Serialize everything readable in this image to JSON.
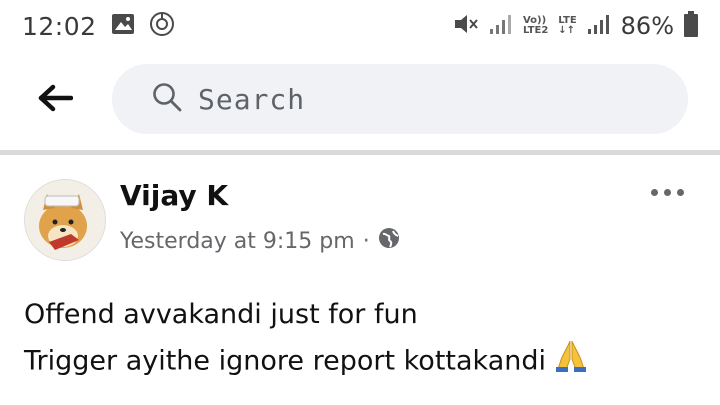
{
  "status_bar": {
    "time": "12:02",
    "icons": [
      "image-icon",
      "sync-icon",
      "mute-icon",
      "signal-icon",
      "signal-icon"
    ],
    "volte_label": "Vo))",
    "lte2_label": "LTE2",
    "lte_label": "LTE",
    "battery_text": "86%"
  },
  "header": {
    "back_icon": "arrow-left-icon",
    "search_icon": "search-icon",
    "search_placeholder": "Search"
  },
  "post": {
    "author": "Vijay K",
    "timestamp": "Yesterday at 9:15 pm",
    "separator": "·",
    "audience_icon": "globe-icon",
    "more_icon": "more-horizontal-icon",
    "lines": [
      "Offend avvakandi just for fun",
      "Trigger ayithe ignore report kottakandi"
    ],
    "emoji_icon": "folded-hands-icon"
  },
  "colors": {
    "search_bg": "#f0f2f5",
    "divider": "#d9dadc",
    "meta_text": "#65676b"
  }
}
